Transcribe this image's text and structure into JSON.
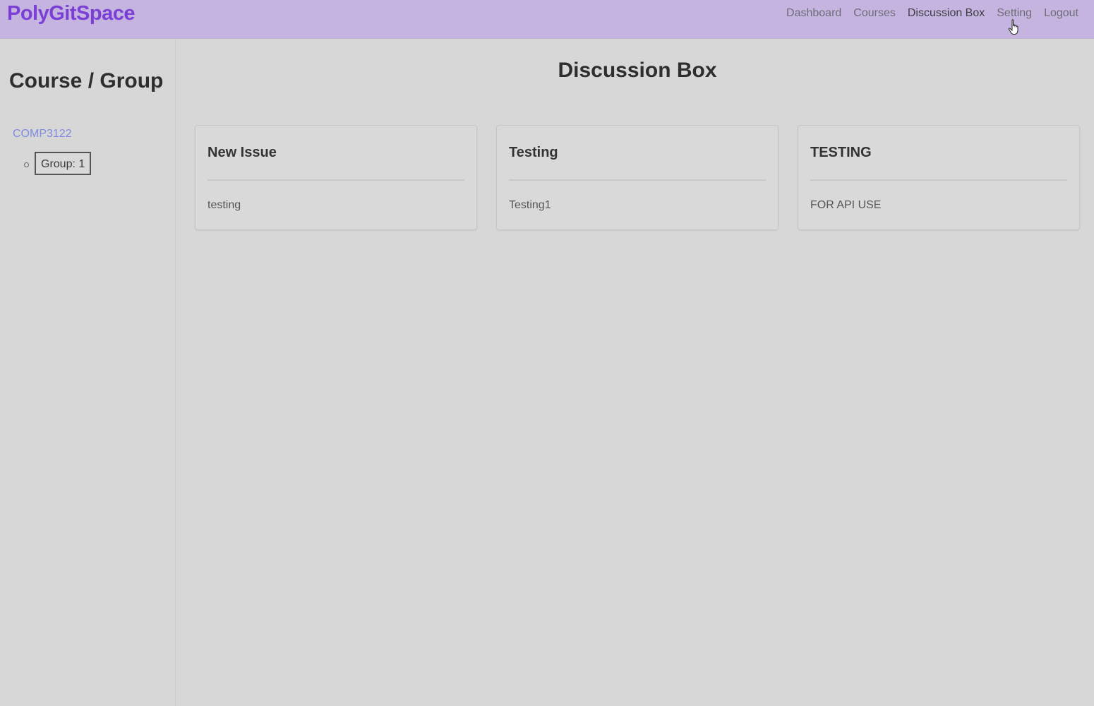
{
  "navbar": {
    "brand": "PolyGitSpace",
    "links": [
      "Dashboard",
      "Courses",
      "Discussion Box",
      "Setting",
      "Logout"
    ]
  },
  "sidebar": {
    "title": "Course / Group",
    "course": "COMP3122",
    "group": "Group: 1"
  },
  "main": {
    "title": "Discussion Box",
    "cards": [
      {
        "title": "New Issue",
        "body": "testing"
      },
      {
        "title": "Testing",
        "body": "Testing1"
      },
      {
        "title": "TESTING",
        "body": "FOR API USE"
      }
    ]
  },
  "colors": {
    "navbar_bg": "#c5b3e0",
    "brand": "#7b3fd6",
    "page_bg": "#d7d7d7",
    "course_link": "#7f8be0"
  },
  "icons": {
    "cursor": "hand-pointer-icon"
  }
}
